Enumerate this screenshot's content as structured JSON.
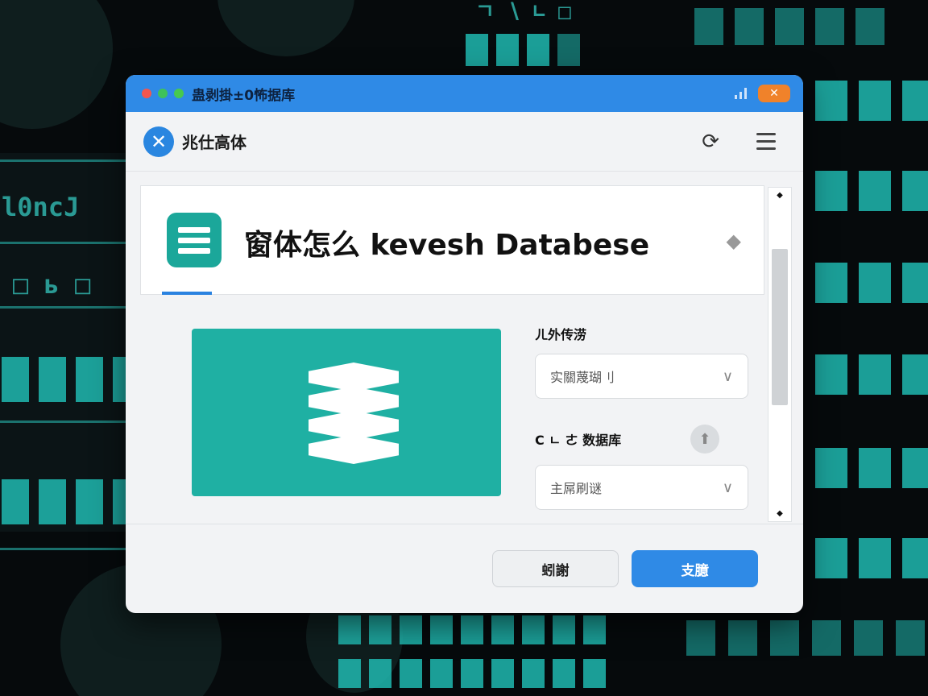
{
  "window": {
    "title": "蛊剥掛±0怖据库"
  },
  "appbar": {
    "app_name": "兆仕高体"
  },
  "header": {
    "title": "窗体怎么 kevesh Databese"
  },
  "form": {
    "field1_label": "ㄦ外传涝",
    "field1_value": "实關蔑瑚刂",
    "field2_label": "C ㄴ ㄜ 数据库",
    "field2_value": "主屌刷谜"
  },
  "footer": {
    "cancel_label": "蚓謝",
    "ok_label": "支臆"
  },
  "colors": {
    "accent": "#2f8ae6",
    "teal": "#1fb0a3",
    "close_button": "#f0822a"
  },
  "icons": {
    "logo": "x-logo-icon",
    "refresh": "refresh-icon",
    "menu": "hamburger-menu-icon",
    "database": "database-stack-icon",
    "chevron": "chevron-down-icon",
    "cloud": "cloud-upload-icon"
  }
}
